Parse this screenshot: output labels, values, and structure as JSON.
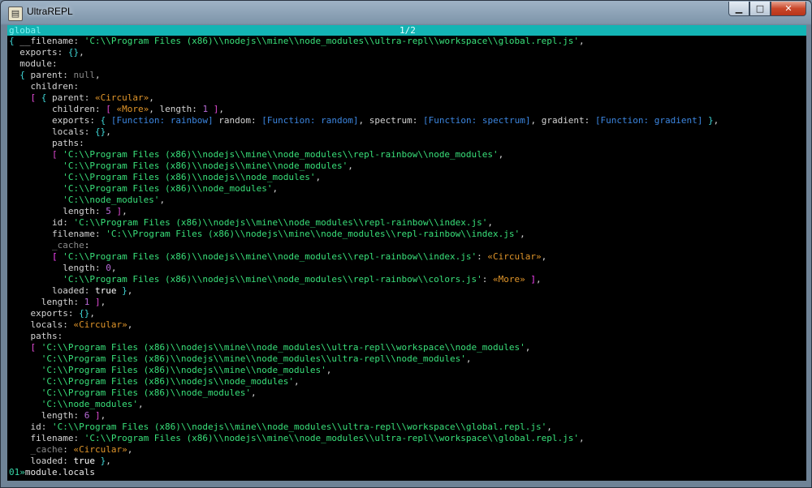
{
  "window": {
    "title": "UltraREPL",
    "app_icon": "terminal-app-icon",
    "controls": {
      "minimize": "▁",
      "maximize": "□",
      "close": "✕"
    }
  },
  "status": {
    "context": "global",
    "page": "1/2"
  },
  "lines": [
    [
      [
        "br1",
        "{ "
      ],
      [
        "k",
        "__filename: "
      ],
      [
        "s",
        "'C:\\\\Program Files (x86)\\\\nodejs\\\\mine\\\\node_modules\\\\ultra-repl\\\\workspace\\\\global.repl.js'"
      ],
      [
        "k",
        ","
      ]
    ],
    [
      [
        "k",
        "  exports: "
      ],
      [
        "br1",
        "{}"
      ],
      [
        "k",
        ","
      ]
    ],
    [
      [
        "k",
        "  module:"
      ]
    ],
    [
      [
        "br1",
        "  { "
      ],
      [
        "k",
        "parent: "
      ],
      [
        "nl",
        "null"
      ],
      [
        "k",
        ","
      ]
    ],
    [
      [
        "k",
        "    children:"
      ]
    ],
    [
      [
        "br2",
        "    [ "
      ],
      [
        "br1",
        "{ "
      ],
      [
        "k",
        "parent: "
      ],
      [
        "c",
        "«Circular»"
      ],
      [
        "k",
        ","
      ]
    ],
    [
      [
        "k",
        "        children: "
      ],
      [
        "br2",
        "[ "
      ],
      [
        "c",
        "«More»"
      ],
      [
        "k",
        ", length: "
      ],
      [
        "n",
        "1"
      ],
      [
        "br2",
        " ]"
      ],
      [
        "k",
        ","
      ]
    ],
    [
      [
        "k",
        "        exports: "
      ],
      [
        "br1",
        "{ "
      ],
      [
        "f",
        "[Function: rainbow]"
      ],
      [
        "k",
        " rand​om: "
      ],
      [
        "f",
        "[Function: random]"
      ],
      [
        "k",
        ", spectrum: "
      ],
      [
        "f",
        "[Function: spectrum]"
      ],
      [
        "k",
        ", gradient: "
      ],
      [
        "f",
        "[Function: gradient]"
      ],
      [
        "br1",
        " }"
      ],
      [
        "k",
        ","
      ]
    ],
    [
      [
        "k",
        "        locals: "
      ],
      [
        "br1",
        "{}"
      ],
      [
        "k",
        ","
      ]
    ],
    [
      [
        "k",
        "        paths:"
      ]
    ],
    [
      [
        "br2",
        "        [ "
      ],
      [
        "s",
        "'C:\\\\Program Files (x86)\\\\nodejs\\\\mine\\\\node_modules\\\\repl-rainbow\\\\node_modules'"
      ],
      [
        "k",
        ","
      ]
    ],
    [
      [
        "s",
        "          'C:\\\\Program Files (x86)\\\\nodejs\\\\mine\\\\node_modules'"
      ],
      [
        "k",
        ","
      ]
    ],
    [
      [
        "s",
        "          'C:\\\\Program Files (x86)\\\\nodejs\\\\node_modules'"
      ],
      [
        "k",
        ","
      ]
    ],
    [
      [
        "s",
        "          'C:\\\\Program Files (x86)\\\\node_modules'"
      ],
      [
        "k",
        ","
      ]
    ],
    [
      [
        "s",
        "          'C:\\\\node_modules'"
      ],
      [
        "k",
        ","
      ]
    ],
    [
      [
        "k",
        "          length: "
      ],
      [
        "n",
        "5"
      ],
      [
        "br2",
        " ]"
      ],
      [
        "k",
        ","
      ]
    ],
    [
      [
        "k",
        "        id: "
      ],
      [
        "s",
        "'C:\\\\Program Files (x86)\\\\nodejs\\\\mine\\\\node_modules\\\\repl-rainbow\\\\index.js'"
      ],
      [
        "k",
        ","
      ]
    ],
    [
      [
        "k",
        "        filename: "
      ],
      [
        "s",
        "'C:\\\\Program Files (x86)\\\\nodejs\\\\mine\\\\node_modules\\\\repl-rainbow\\\\index.js'"
      ],
      [
        "k",
        ","
      ]
    ],
    [
      [
        "nl",
        "        _cache"
      ],
      [
        "k",
        ":"
      ]
    ],
    [
      [
        "br3",
        "        [ "
      ],
      [
        "s",
        "'C:\\\\Program Files (x86)\\\\nodejs\\\\mine\\\\node_modules\\\\repl-rainbow\\\\index.js'"
      ],
      [
        "k",
        ": "
      ],
      [
        "c",
        "«Circular»"
      ],
      [
        "k",
        ","
      ]
    ],
    [
      [
        "k",
        "          length: "
      ],
      [
        "n",
        "0"
      ],
      [
        "k",
        ","
      ]
    ],
    [
      [
        "s",
        "          'C:\\\\Program Files (x86)\\\\nodejs\\\\mine\\\\node_modules\\\\repl-rainbow\\\\colors.js'"
      ],
      [
        "k",
        ": "
      ],
      [
        "c",
        "«More»"
      ],
      [
        "br3",
        " ]"
      ],
      [
        "k",
        ","
      ]
    ],
    [
      [
        "k",
        "        loaded: "
      ],
      [
        "b",
        "true"
      ],
      [
        "br1",
        " }"
      ],
      [
        "k",
        ","
      ]
    ],
    [
      [
        "k",
        "      length: "
      ],
      [
        "n",
        "1"
      ],
      [
        "br2",
        " ]"
      ],
      [
        "k",
        ","
      ]
    ],
    [
      [
        "k",
        "    exports: "
      ],
      [
        "br1",
        "{}"
      ],
      [
        "k",
        ","
      ]
    ],
    [
      [
        "k",
        "    locals: "
      ],
      [
        "c",
        "«Circular»"
      ],
      [
        "k",
        ","
      ]
    ],
    [
      [
        "k",
        "    paths:"
      ]
    ],
    [
      [
        "br2",
        "    [ "
      ],
      [
        "s",
        "'C:\\\\Program Files (x86)\\\\nodejs\\\\mine\\\\node_modules\\\\ultra-repl\\\\workspace\\\\node_modules'"
      ],
      [
        "k",
        ","
      ]
    ],
    [
      [
        "s",
        "      'C:\\\\Program Files (x86)\\\\nodejs\\\\mine\\\\node_modules\\\\ultra-repl\\\\node_modules'"
      ],
      [
        "k",
        ","
      ]
    ],
    [
      [
        "s",
        "      'C:\\\\Program Files (x86)\\\\nodejs\\\\mine\\\\node_modules'"
      ],
      [
        "k",
        ","
      ]
    ],
    [
      [
        "s",
        "      'C:\\\\Program Files (x86)\\\\nodejs\\\\node_modules'"
      ],
      [
        "k",
        ","
      ]
    ],
    [
      [
        "s",
        "      'C:\\\\Program Files (x86)\\\\node_modules'"
      ],
      [
        "k",
        ","
      ]
    ],
    [
      [
        "s",
        "      'C:\\\\node_modules'"
      ],
      [
        "k",
        ","
      ]
    ],
    [
      [
        "k",
        "      length: "
      ],
      [
        "n",
        "6"
      ],
      [
        "br2",
        " ]"
      ],
      [
        "k",
        ","
      ]
    ],
    [
      [
        "k",
        "    id: "
      ],
      [
        "s",
        "'C:\\\\Program Files (x86)\\\\nodejs\\\\mine\\\\node_modules\\\\ultra-repl\\\\workspace\\\\global.repl.js'"
      ],
      [
        "k",
        ","
      ]
    ],
    [
      [
        "k",
        "    filename: "
      ],
      [
        "s",
        "'C:\\\\Program Files (x86)\\\\nodejs\\\\mine\\\\node_modules\\\\ultra-repl\\\\workspace\\\\global.repl.js'"
      ],
      [
        "k",
        ","
      ]
    ],
    [
      [
        "nl",
        "    _cache"
      ],
      [
        "k",
        ": "
      ],
      [
        "c",
        "«Circular»"
      ],
      [
        "k",
        ","
      ]
    ],
    [
      [
        "k",
        "    loaded: "
      ],
      [
        "b",
        "true"
      ],
      [
        "br1",
        " }"
      ],
      [
        "k",
        ","
      ]
    ]
  ],
  "prompt": {
    "marker": "01»",
    "command": "module.locals"
  },
  "colors": {
    "status_bar": "#13b4b4",
    "string": "#39e07a",
    "number": "#b96bd8",
    "circular": "#e0952a",
    "function": "#3c86e0"
  }
}
